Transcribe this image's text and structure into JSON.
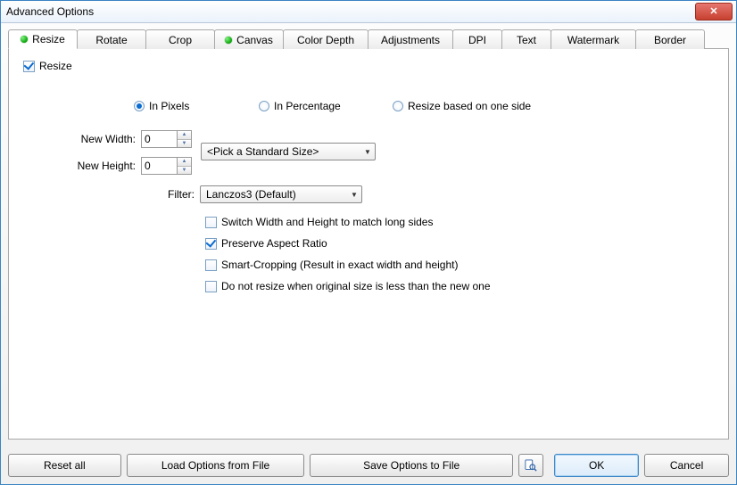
{
  "window": {
    "title": "Advanced Options"
  },
  "tabs": [
    {
      "label": "Resize",
      "dot": true,
      "active": true
    },
    {
      "label": "Rotate",
      "dot": false
    },
    {
      "label": "Crop",
      "dot": false
    },
    {
      "label": "Canvas",
      "dot": true
    },
    {
      "label": "Color Depth",
      "dot": false
    },
    {
      "label": "Adjustments",
      "dot": false
    },
    {
      "label": "DPI",
      "dot": false
    },
    {
      "label": "Text",
      "dot": false
    },
    {
      "label": "Watermark",
      "dot": false
    },
    {
      "label": "Border",
      "dot": false
    }
  ],
  "resize": {
    "enable_label": "Resize",
    "enable_checked": true,
    "mode": {
      "pixels": {
        "label": "In Pixels",
        "checked": true
      },
      "percent": {
        "label": "In Percentage",
        "checked": false
      },
      "oneside": {
        "label": "Resize based on one side",
        "checked": false
      }
    },
    "width_label": "New Width:",
    "width_value": "0",
    "height_label": "New Height:",
    "height_value": "0",
    "std_size_label": "<Pick a Standard Size>",
    "filter_label": "Filter:",
    "filter_value": "Lanczos3 (Default)",
    "opt_switch": {
      "label": "Switch Width and Height to match long sides",
      "checked": false
    },
    "opt_aspect": {
      "label": "Preserve Aspect Ratio",
      "checked": true
    },
    "opt_smart": {
      "label": "Smart-Cropping (Result in exact width and height)",
      "checked": false
    },
    "opt_noshrink": {
      "label": "Do not resize when original size is less than the new one",
      "checked": false
    }
  },
  "buttons": {
    "reset": "Reset all",
    "load": "Load Options from File",
    "save": "Save Options to File",
    "ok": "OK",
    "cancel": "Cancel"
  },
  "tab_widths": [
    64,
    64,
    64,
    64,
    82,
    82,
    42,
    42,
    82,
    64
  ]
}
